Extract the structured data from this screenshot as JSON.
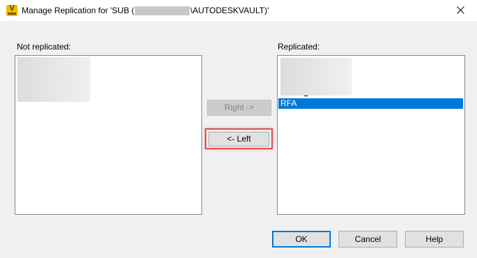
{
  "window": {
    "title_prefix": "Manage Replication for 'SUB (",
    "title_suffix": "\\AUTODESKVAULT)'",
    "icon_letter": "V",
    "accent": "#f5b800"
  },
  "left_list": {
    "label": "Not replicated:"
  },
  "right_list": {
    "label": "Replicated:",
    "selected_item": "RFA"
  },
  "buttons": {
    "right": "Right ->",
    "left": "<- Left",
    "ok": "OK",
    "cancel": "Cancel",
    "help": "Help"
  },
  "colors": {
    "selection": "#0078d7",
    "highlight": "#e05050"
  }
}
